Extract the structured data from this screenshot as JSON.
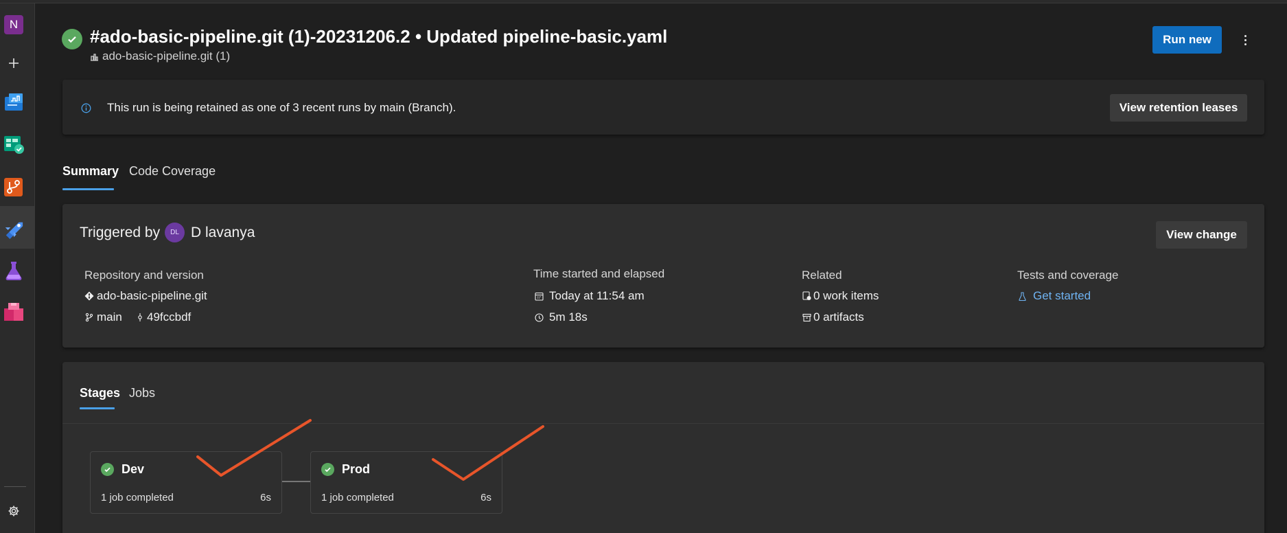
{
  "header": {
    "title": "#ado-basic-pipeline.git (1)-20231206.2 • Updated pipeline-basic.yaml",
    "repo": "ado-basic-pipeline.git (1)",
    "run_new": "Run new"
  },
  "rail": {
    "project_initial": "N"
  },
  "banner": {
    "message": "This run is being retained as one of 3 recent runs by main (Branch).",
    "button": "View retention leases"
  },
  "tabs": [
    "Summary",
    "Code Coverage"
  ],
  "summary": {
    "triggered_by": "Triggered by",
    "avatar_initials": "DL",
    "user": "D lavanya",
    "view_change": "View change",
    "repository": {
      "heading": "Repository and version",
      "repo": "ado-basic-pipeline.git",
      "branch": "main",
      "commit": "49fccbdf"
    },
    "time": {
      "heading": "Time started and elapsed",
      "started": "Today at 11:54 am",
      "elapsed": "5m 18s"
    },
    "related": {
      "heading": "Related",
      "work_items": "0 work items",
      "artifacts": "0 artifacts"
    },
    "tests": {
      "heading": "Tests and coverage",
      "link": "Get started"
    }
  },
  "stage_tabs": [
    "Stages",
    "Jobs"
  ],
  "stages": [
    {
      "name": "Dev",
      "jobs": "1 job completed",
      "duration": "6s"
    },
    {
      "name": "Prod",
      "jobs": "1 job completed",
      "duration": "6s"
    }
  ],
  "colors": {
    "success": "#5aa85f",
    "primary": "#0f6cbd",
    "link": "#6fb3f2",
    "annotation": "#e8552a"
  }
}
